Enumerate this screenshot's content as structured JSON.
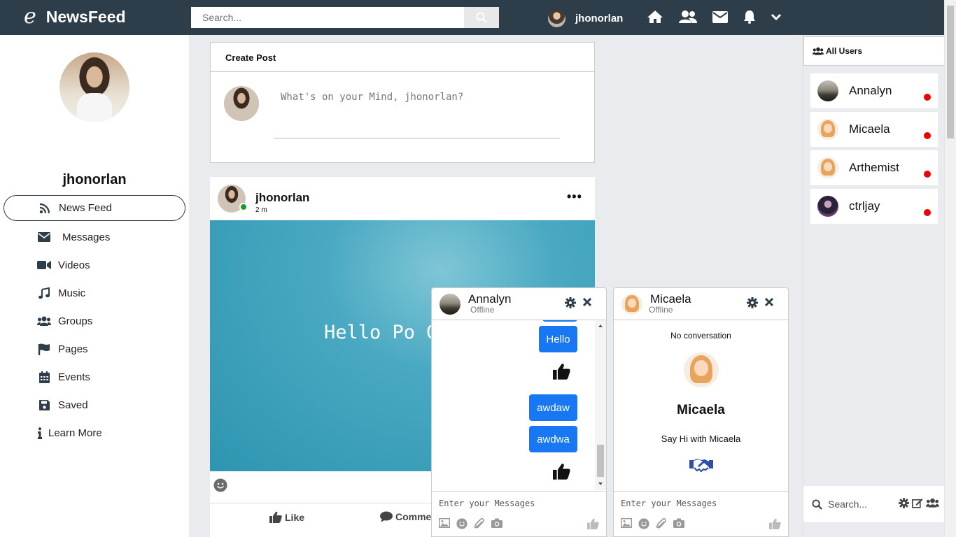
{
  "topbar": {
    "logo_glyph": "e",
    "app_name": "NewsFeed",
    "search_placeholder": "Search...",
    "username": "jhonorlan",
    "icons": [
      "home-icon",
      "friends-icon",
      "envelope-icon",
      "bell-icon",
      "chevron-down-icon"
    ]
  },
  "sidebar": {
    "profile_name": "jhonorlan",
    "items": [
      {
        "label": "News Feed",
        "icon": "rss-icon",
        "active": true
      },
      {
        "label": "Messages",
        "icon": "envelope-icon"
      },
      {
        "label": "Videos",
        "icon": "video-icon"
      },
      {
        "label": "Music",
        "icon": "music-icon"
      },
      {
        "label": "Groups",
        "icon": "users-icon"
      },
      {
        "label": "Pages",
        "icon": "flag-icon"
      },
      {
        "label": "Events",
        "icon": "calendar-icon"
      },
      {
        "label": "Saved",
        "icon": "floppy-icon"
      },
      {
        "label": "Learn More",
        "icon": "info-icon"
      }
    ]
  },
  "create_post": {
    "title": "Create Post",
    "placeholder": "What's on your Mind, jhonorlan?"
  },
  "post": {
    "user": "jhonorlan",
    "time": "2 m",
    "more": "•••",
    "text": "Hello Po Guys",
    "like_label": "Like",
    "comment_label": "Comment"
  },
  "right_panel": {
    "title": "All Users",
    "users": [
      {
        "name": "Annalyn",
        "status_color": "#ee0000"
      },
      {
        "name": "Micaela",
        "status_color": "#ee0000"
      },
      {
        "name": "Arthemist",
        "status_color": "#ee0000"
      },
      {
        "name": "ctrljay",
        "status_color": "#ee0000"
      }
    ],
    "search_placeholder": "Search..."
  },
  "chats": [
    {
      "name": "Annalyn",
      "status": "Offline",
      "messages": [
        "Hello",
        "awdaw",
        "awdwa"
      ],
      "input_placeholder": "Enter your Messages"
    },
    {
      "name": "Micaela",
      "status": "Offline",
      "empty_text": "No conversation",
      "say_hi": "Say Hi with Micaela",
      "input_placeholder": "Enter your Messages"
    }
  ],
  "colors": {
    "topbar": "#2d3e4a",
    "bubble": "#1877f2",
    "offline_dot": "#ee0000",
    "online_dot": "#1a9c2b"
  }
}
